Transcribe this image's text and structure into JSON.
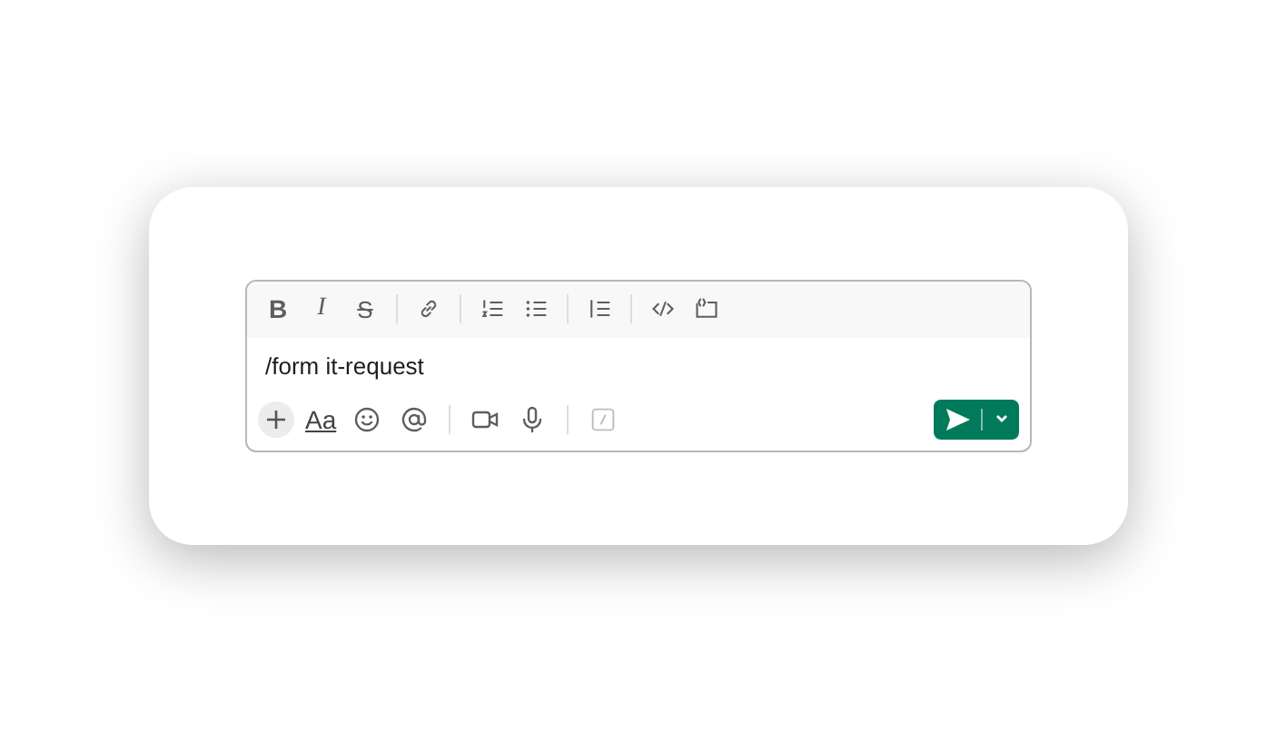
{
  "format_toolbar": [
    {
      "kind": "bold",
      "label": "B"
    },
    {
      "kind": "italic",
      "label": "I"
    },
    {
      "kind": "strike",
      "label": "S"
    },
    {
      "kind": "divider"
    },
    {
      "kind": "link"
    },
    {
      "kind": "divider"
    },
    {
      "kind": "ordered-list"
    },
    {
      "kind": "bullet-list"
    },
    {
      "kind": "divider"
    },
    {
      "kind": "quote"
    },
    {
      "kind": "divider"
    },
    {
      "kind": "code"
    },
    {
      "kind": "code-block"
    }
  ],
  "message": {
    "value": "/form it-request"
  },
  "actions": [
    {
      "kind": "plus"
    },
    {
      "kind": "text-format",
      "label": "Aa"
    },
    {
      "kind": "emoji"
    },
    {
      "kind": "mention"
    },
    {
      "kind": "divider"
    },
    {
      "kind": "video"
    },
    {
      "kind": "mic"
    },
    {
      "kind": "divider"
    },
    {
      "kind": "shortcut"
    }
  ],
  "send": {
    "enabled": true
  }
}
